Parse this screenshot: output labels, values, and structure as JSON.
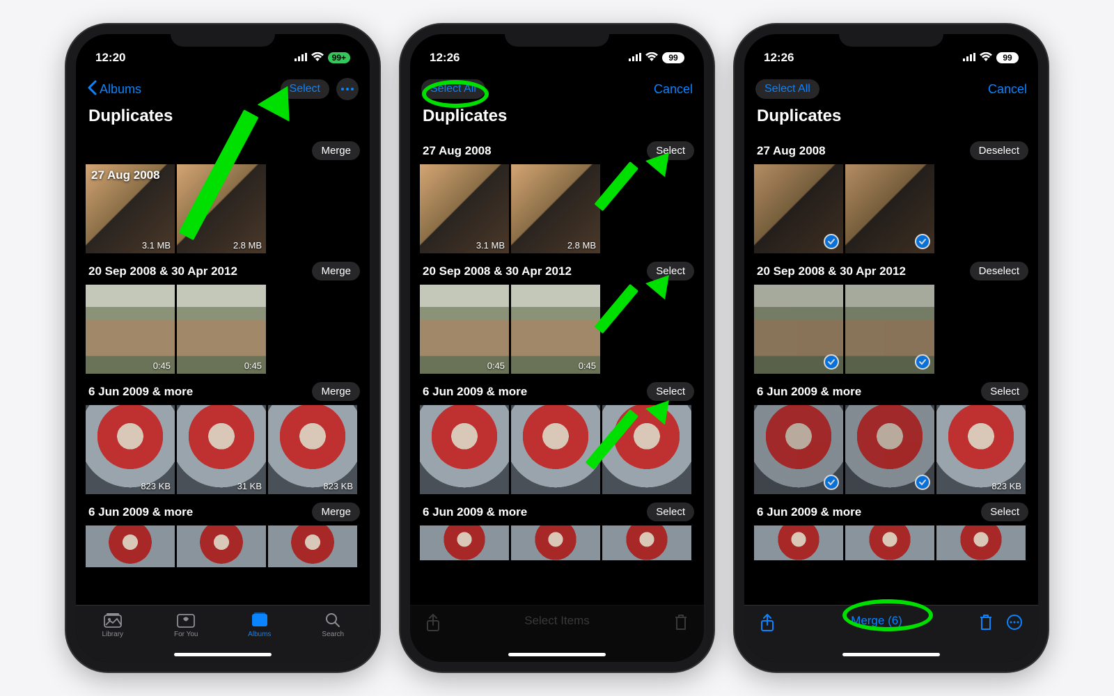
{
  "phones": [
    {
      "time": "12:20",
      "battery": "99+",
      "battery_style": "green",
      "nav": {
        "back": "Albums",
        "select": "Select"
      },
      "title": "Duplicates",
      "tabs": [
        "Library",
        "For You",
        "Albums",
        "Search"
      ],
      "active_tab": 2,
      "groups": [
        {
          "date_inline": "27 Aug 2008",
          "date": "",
          "action": "Merge",
          "thumbs": [
            {
              "cls": "p-face",
              "meta": "3.1 MB"
            },
            {
              "cls": "p-face",
              "meta": "2.8 MB"
            }
          ]
        },
        {
          "date": "20 Sep 2008 & 30 Apr 2012",
          "action": "Merge",
          "thumbs": [
            {
              "cls": "p-swan",
              "meta": "0:45"
            },
            {
              "cls": "p-swan",
              "meta": "0:45"
            }
          ]
        },
        {
          "date": "6 Jun 2009 & more",
          "action": "Merge",
          "thumbs": [
            {
              "cls": "p-red",
              "meta": "823 KB"
            },
            {
              "cls": "p-red",
              "meta": "31 KB"
            },
            {
              "cls": "p-red",
              "meta": "823 KB"
            }
          ]
        },
        {
          "date": "6 Jun 2009 & more",
          "action": "Merge",
          "thumbs": [
            {
              "cls": "p-red2",
              "meta": ""
            },
            {
              "cls": "p-red2",
              "meta": ""
            },
            {
              "cls": "p-red2",
              "meta": ""
            }
          ]
        }
      ]
    },
    {
      "time": "12:26",
      "battery": "99",
      "battery_style": "white",
      "nav": {
        "select_all": "Select All",
        "cancel": "Cancel"
      },
      "title": "Duplicates",
      "toolbar_center": "Select Items",
      "groups": [
        {
          "date": "27 Aug 2008",
          "action": "Select",
          "thumbs": [
            {
              "cls": "p-face",
              "meta": "3.1 MB"
            },
            {
              "cls": "p-face",
              "meta": "2.8 MB"
            }
          ]
        },
        {
          "date": "20 Sep 2008 & 30 Apr 2012",
          "action": "Select",
          "thumbs": [
            {
              "cls": "p-swan",
              "meta": "0:45"
            },
            {
              "cls": "p-swan",
              "meta": "0:45"
            }
          ]
        },
        {
          "date": "6 Jun 2009 & more",
          "action": "Select",
          "thumbs": [
            {
              "cls": "p-red",
              "meta": ""
            },
            {
              "cls": "p-red",
              "meta": ""
            },
            {
              "cls": "p-red",
              "meta": ""
            }
          ]
        },
        {
          "date": "6 Jun 2009 & more",
          "action": "Select",
          "thumbs": [
            {
              "cls": "p-red2",
              "meta": ""
            },
            {
              "cls": "p-red2",
              "meta": ""
            },
            {
              "cls": "p-red2",
              "meta": ""
            }
          ]
        }
      ]
    },
    {
      "time": "12:26",
      "battery": "99",
      "battery_style": "white",
      "nav": {
        "select_all": "Select All",
        "cancel": "Cancel"
      },
      "title": "Duplicates",
      "toolbar_center": "Merge (6)",
      "groups": [
        {
          "date": "27 Aug 2008",
          "action": "Deselect",
          "thumbs": [
            {
              "cls": "p-face",
              "meta": "",
              "check": true
            },
            {
              "cls": "p-face",
              "meta": "",
              "check": true
            }
          ]
        },
        {
          "date": "20 Sep 2008 & 30 Apr 2012",
          "action": "Deselect",
          "thumbs": [
            {
              "cls": "p-swan",
              "meta": "",
              "check": true
            },
            {
              "cls": "p-swan",
              "meta": "",
              "check": true
            }
          ]
        },
        {
          "date": "6 Jun 2009 & more",
          "action": "Select",
          "thumbs": [
            {
              "cls": "p-red",
              "meta": "",
              "check": true
            },
            {
              "cls": "p-red",
              "meta": "",
              "check": true
            },
            {
              "cls": "p-red",
              "meta": "823 KB"
            }
          ]
        },
        {
          "date": "6 Jun 2009 & more",
          "action": "Select",
          "thumbs": [
            {
              "cls": "p-red2",
              "meta": ""
            },
            {
              "cls": "p-red2",
              "meta": ""
            },
            {
              "cls": "p-red2",
              "meta": ""
            }
          ]
        }
      ]
    }
  ]
}
